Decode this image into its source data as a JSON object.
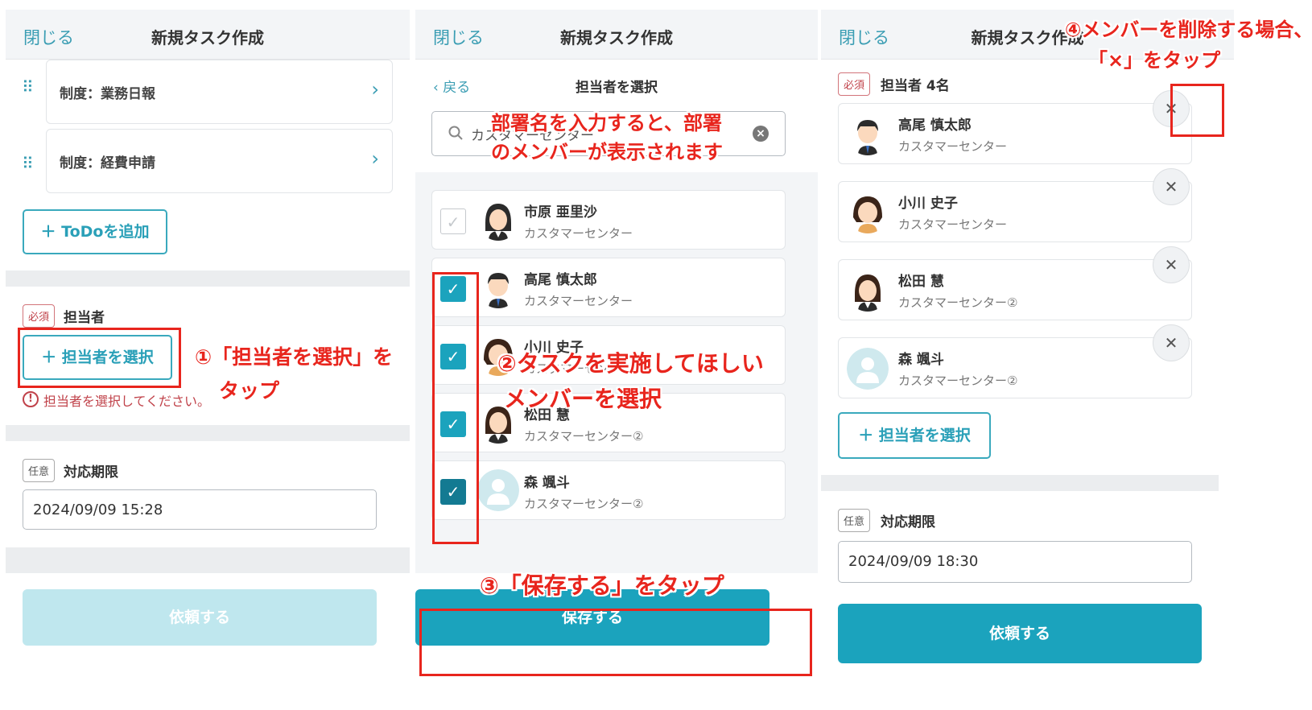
{
  "panel1": {
    "header": {
      "close": "閉じる",
      "title": "新規タスク作成"
    },
    "todos": [
      "制度：業務日報",
      "制度：経費申請"
    ],
    "add_todo": "＋ ToDoを追加",
    "assignee": {
      "tag": "必須",
      "label": "担当者",
      "select_button": "＋ 担当者を選択",
      "error": "担当者を選択してください。"
    },
    "deadline": {
      "tag": "任意",
      "label": "対応期限",
      "value": "2024/09/09 15:28"
    },
    "submit": "依頼する"
  },
  "panel2": {
    "header": {
      "close": "閉じる",
      "title": "新規タスク作成"
    },
    "back": "戻る",
    "subtitle": "担当者を選択",
    "search_value": "カスタマーセンター",
    "members": [
      {
        "name": "市原 亜里沙",
        "dept": "カスタマーセンター",
        "checked": false
      },
      {
        "name": "高尾 慎太郎",
        "dept": "カスタマーセンター",
        "checked": true
      },
      {
        "name": "小川 史子",
        "dept": "カスタマーセンター",
        "checked": true
      },
      {
        "name": "松田 慧",
        "dept": "カスタマーセンター②",
        "checked": true
      },
      {
        "name": "森 颯斗",
        "dept": "カスタマーセンター②",
        "checked": true
      }
    ],
    "save": "保存する"
  },
  "panel3": {
    "header": {
      "close": "閉じる",
      "title": "新規タスク作成"
    },
    "assignee": {
      "tag": "必須",
      "label": "担当者 4名"
    },
    "members": [
      {
        "name": "高尾 慎太郎",
        "dept": "カスタマーセンター"
      },
      {
        "name": "小川 史子",
        "dept": "カスタマーセンター"
      },
      {
        "name": "松田 慧",
        "dept": "カスタマーセンター②"
      },
      {
        "name": "森 颯斗",
        "dept": "カスタマーセンター②"
      }
    ],
    "select_button": "＋ 担当者を選択",
    "deadline": {
      "tag": "任意",
      "label": "対応期限",
      "value": "2024/09/09 18:30"
    },
    "submit": "依頼する"
  },
  "annotations": {
    "a1_line1": "①「担当者を選択」を",
    "a1_line2": "タップ",
    "search_line1": "部署名を入力すると、部署",
    "search_line2": "のメンバーが表示されます",
    "a2_line1": "②タスクを実施してほしい",
    "a2_line2": "メンバーを選択",
    "a3": "③「保存する」をタップ",
    "a4_line1": "④メンバーを削除する場合、",
    "a4_line2": "「×」をタップ"
  },
  "colors": {
    "accent": "#1ba3bd",
    "disabled": "#bfe7ee",
    "required": "#c0424a",
    "annotation": "#e8251d"
  }
}
